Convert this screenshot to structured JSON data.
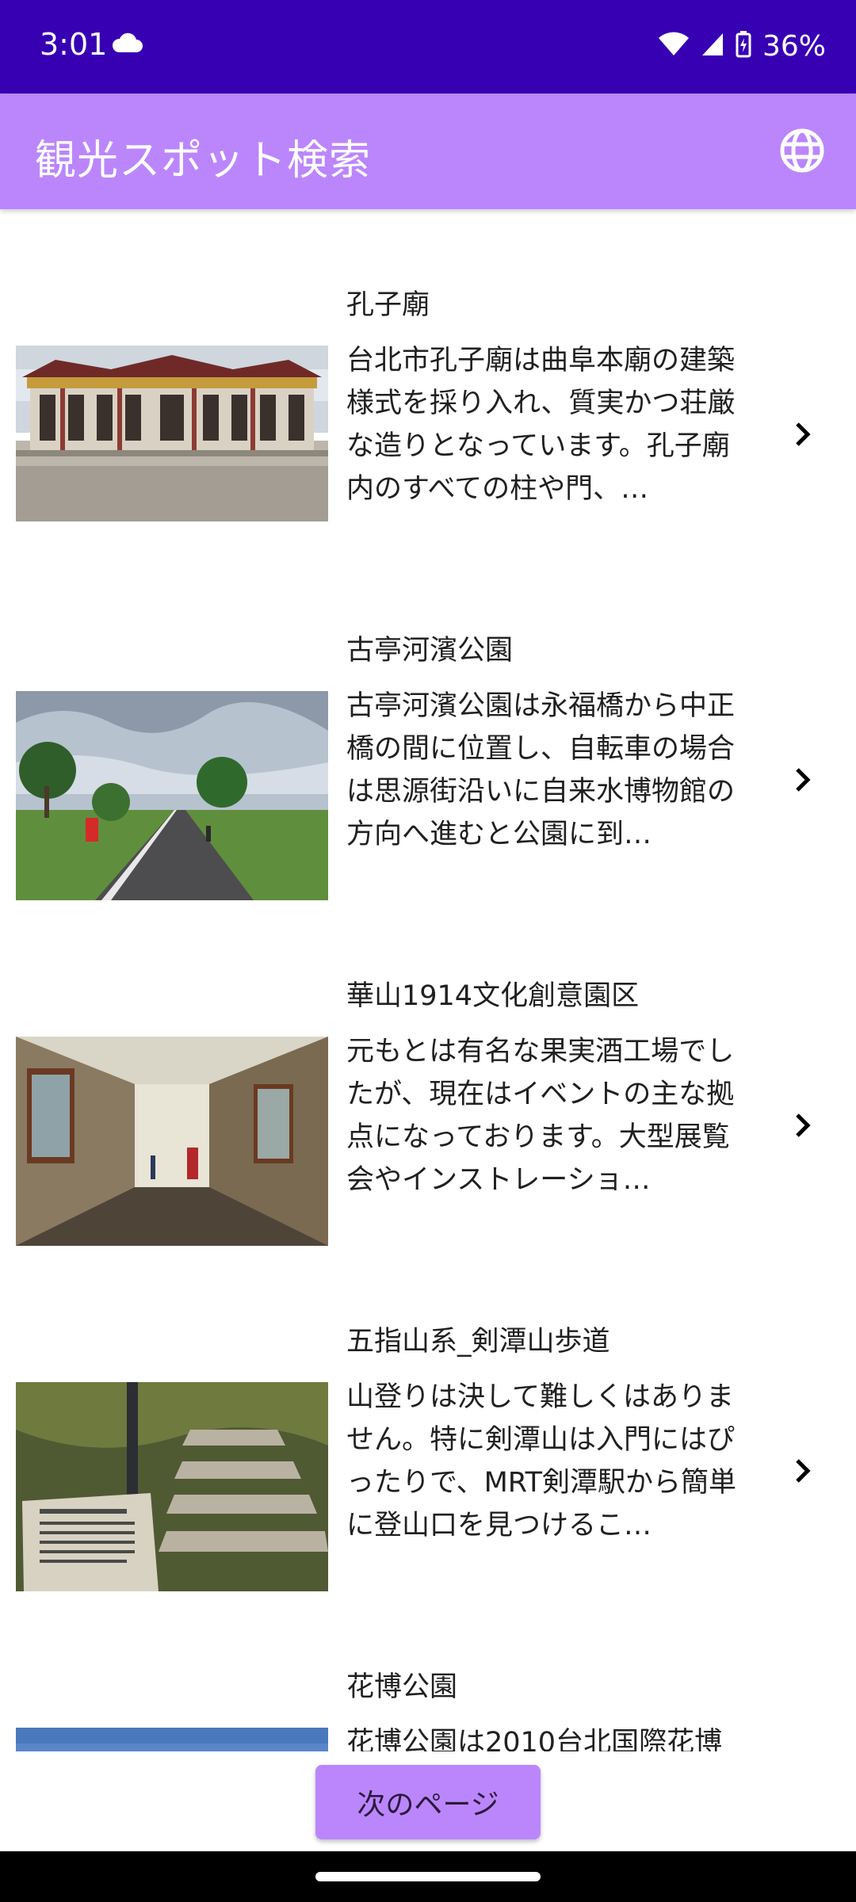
{
  "status_bar": {
    "time": "3:01",
    "battery": "36%"
  },
  "app_bar": {
    "title": "観光スポット検索"
  },
  "items": [
    {
      "title": "孔子廟",
      "description": "台北市孔子廟は曲阜本廟の建築様式を採り入れ、質実かつ荘厳な造りとなっています。孔子廟内のすべての柱や門、…"
    },
    {
      "title": "古亭河濱公園",
      "description": "古亭河濱公園は永福橋から中正橋の間に位置し、自転車の場合は思源街沿いに自来水博物館の方向へ進むと公園に到…"
    },
    {
      "title": "華山1914文化創意園区",
      "description": "元もとは有名な果実酒工場でしたが、現在はイベントの主な拠点になっております。大型展覧会やインストレーショ…"
    },
    {
      "title": "五指山系_剣潭山歩道",
      "description": "山登りは決して難しくはありません。特に剣潭山は入門にはぴったりで、MRT剣潭駅から簡単に登山口を見つけるこ…"
    },
    {
      "title": "花博公園",
      "description": "花博公園は2010台北国際花博"
    }
  ],
  "next_button": {
    "label": "次のページ"
  },
  "icons": {
    "globe": "globe-icon",
    "chevron": "chevron-right-icon",
    "cloud": "cloud-icon"
  },
  "colors": {
    "status_bar": "#3700b3",
    "app_bar": "#bb86fc",
    "button": "#bb86fc"
  }
}
